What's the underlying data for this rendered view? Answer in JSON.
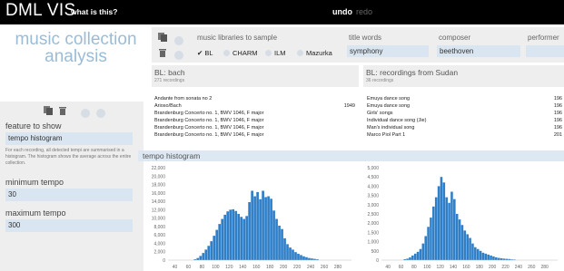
{
  "header": {
    "logo": "DML VIS",
    "help": "what is this?",
    "undo": "undo",
    "redo": "redo"
  },
  "title_line1": "music collection",
  "title_line2": "analysis",
  "query": {
    "libraries_label": "music libraries to sample",
    "libraries": [
      {
        "label": "BL",
        "checked": true
      },
      {
        "label": "CHARM",
        "checked": false
      },
      {
        "label": "ILM",
        "checked": false
      },
      {
        "label": "Mazurka",
        "checked": false
      }
    ],
    "title_words_label": "title words",
    "title_words_value": "symphony",
    "composer_label": "composer",
    "composer_value": "beethoven",
    "performer_label": "performer",
    "performer_value": ""
  },
  "collections": [
    {
      "title": "BL: bach",
      "count": "271 recordings"
    },
    {
      "title": "BL: recordings from Sudan",
      "count": "36 recordings"
    }
  ],
  "left_list": [
    {
      "title": "Andante from sonata no 2",
      "year": ""
    },
    {
      "title": "Arioso/Bach",
      "year": "1949"
    },
    {
      "title": "Brandenburg Concerto no. 1, BWV 1046, F major",
      "year": ""
    },
    {
      "title": "Brandenburg Concerto no. 1, BWV 1046, F major",
      "year": ""
    },
    {
      "title": "Brandenburg Concerto no. 1, BWV 1046, F major",
      "year": ""
    },
    {
      "title": "Brandenburg Concerto no. 1, BWV 1046, F major",
      "year": ""
    }
  ],
  "right_list": [
    {
      "title": "Emuya dance song",
      "year": "196"
    },
    {
      "title": "Emuya dance song",
      "year": "196"
    },
    {
      "title": "Girls' songs",
      "year": "196"
    },
    {
      "title": "Individual dance song (Jie)",
      "year": "196"
    },
    {
      "title": "Man's individual song",
      "year": "196"
    },
    {
      "title": "Marco Piol Part 1",
      "year": "201"
    }
  ],
  "sidebar": {
    "feature_label": "feature to show",
    "feature_value": "tempo histogram",
    "description": "For each recording, all detected tempi are summarised in a histogram. The histogram shows the average across the entire collection.",
    "min_label": "minimum tempo",
    "min_value": "30",
    "max_label": "maximum tempo",
    "max_value": "300"
  },
  "chart_title": "tempo histogram",
  "colors": {
    "bar": "#2f7fc8",
    "accent": "#9bbcd6",
    "panel": "#eeeeee",
    "field": "#d9e6f1"
  },
  "chart_data": [
    {
      "type": "bar",
      "title": "",
      "x_ticks": [
        40,
        60,
        80,
        100,
        120,
        140,
        160,
        180,
        200,
        220,
        240,
        260,
        280
      ],
      "y_ticks": [
        0,
        2000,
        4000,
        6000,
        8000,
        10000,
        12000,
        14000,
        16000,
        18000,
        20000,
        22000
      ],
      "y_tick_labels": [
        "0",
        "2,000",
        "4,000",
        "6,000",
        "8,000",
        "10,000",
        "12,000",
        "14,000",
        "16,000",
        "18,000",
        "20,000",
        "22,000"
      ],
      "xlim": [
        30,
        300
      ],
      "ylim": [
        0,
        22000
      ],
      "bin_width": 4,
      "x": [
        70,
        74,
        78,
        82,
        86,
        90,
        94,
        98,
        102,
        106,
        110,
        114,
        118,
        122,
        126,
        130,
        134,
        138,
        142,
        146,
        150,
        154,
        158,
        162,
        166,
        170,
        174,
        178,
        182,
        186,
        190,
        194,
        198,
        202,
        206,
        210,
        214,
        218,
        222,
        226,
        230,
        234,
        238,
        242,
        246,
        250
      ],
      "values": [
        200,
        500,
        1000,
        1700,
        2500,
        3400,
        4500,
        5800,
        7200,
        8600,
        9800,
        10800,
        11600,
        12000,
        12100,
        11700,
        11000,
        10300,
        9800,
        10500,
        13800,
        16500,
        15200,
        16200,
        14500,
        16500,
        15000,
        15200,
        14600,
        11800,
        9800,
        8200,
        7400,
        5200,
        3800,
        3000,
        2500,
        1900,
        1500,
        1200,
        900,
        700,
        500,
        400,
        300,
        200
      ]
    },
    {
      "type": "bar",
      "title": "",
      "x_ticks": [
        40,
        60,
        80,
        100,
        120,
        140,
        160,
        180,
        200,
        220,
        240,
        260,
        280
      ],
      "y_ticks": [
        0,
        500,
        1000,
        1500,
        2000,
        2500,
        3000,
        3500,
        4000,
        4500,
        5000
      ],
      "y_tick_labels": [
        "0",
        "500",
        "1,000",
        "1,500",
        "2,000",
        "2,500",
        "3,000",
        "3,500",
        "4,000",
        "4,500",
        "5,000"
      ],
      "xlim": [
        30,
        300
      ],
      "ylim": [
        0,
        5000
      ],
      "bin_width": 4,
      "x": [
        66,
        70,
        74,
        78,
        82,
        86,
        90,
        94,
        98,
        102,
        106,
        110,
        114,
        118,
        122,
        126,
        130,
        134,
        138,
        142,
        146,
        150,
        154,
        158,
        162,
        166,
        170,
        174,
        178,
        182,
        186,
        190,
        194,
        198,
        202,
        206,
        210,
        214,
        218,
        222,
        226,
        230,
        234
      ],
      "values": [
        50,
        80,
        150,
        250,
        350,
        450,
        600,
        900,
        1300,
        1800,
        2300,
        2900,
        3400,
        4000,
        4500,
        4200,
        3400,
        3100,
        3700,
        3300,
        2500,
        2200,
        1900,
        1600,
        1400,
        1200,
        900,
        700,
        600,
        500,
        400,
        350,
        300,
        250,
        200,
        150,
        120,
        100,
        80,
        70,
        60,
        40,
        30
      ]
    }
  ]
}
